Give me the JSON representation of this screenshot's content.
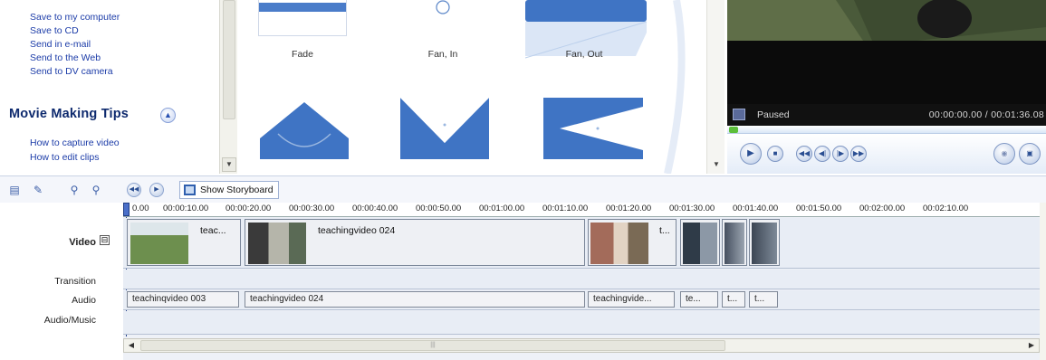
{
  "task_pane": {
    "finish_links": [
      "Save to my computer",
      "Save to CD",
      "Send in e-mail",
      "Send to the Web",
      "Send to DV camera"
    ],
    "tips_title": "Movie Making Tips",
    "tips_links": [
      "How to capture video",
      "How to edit clips"
    ]
  },
  "collection": {
    "items": [
      {
        "label": "Fade"
      },
      {
        "label": "Fan, In"
      },
      {
        "label": "Fan, Out"
      }
    ]
  },
  "monitor": {
    "status": "Paused",
    "time": "00:00:00.00 / 00:01:36.08",
    "progress": 0
  },
  "timeline_toolbar": {
    "show_storyboard_label": "Show Storyboard"
  },
  "timeline": {
    "ruler_ticks": [
      "0.00",
      "00:00:10.00",
      "00:00:20.00",
      "00:00:30.00",
      "00:00:40.00",
      "00:00:50.00",
      "00:01:00.00",
      "00:01:10.00",
      "00:01:20.00",
      "00:01:30.00",
      "00:01:40.00",
      "00:01:50.00",
      "00:02:00.00",
      "00:02:10.00"
    ],
    "tracks": {
      "video": "Video",
      "transition": "Transition",
      "audio": "Audio",
      "audio_music": "Audio/Music"
    },
    "video_clips": [
      "teac...",
      "teachingvideo 024",
      "t..."
    ],
    "audio_clips": [
      "teachinqvideo 003",
      "teachingvideo 024",
      "teachingvide...",
      "te...",
      "t...",
      "t..."
    ]
  }
}
